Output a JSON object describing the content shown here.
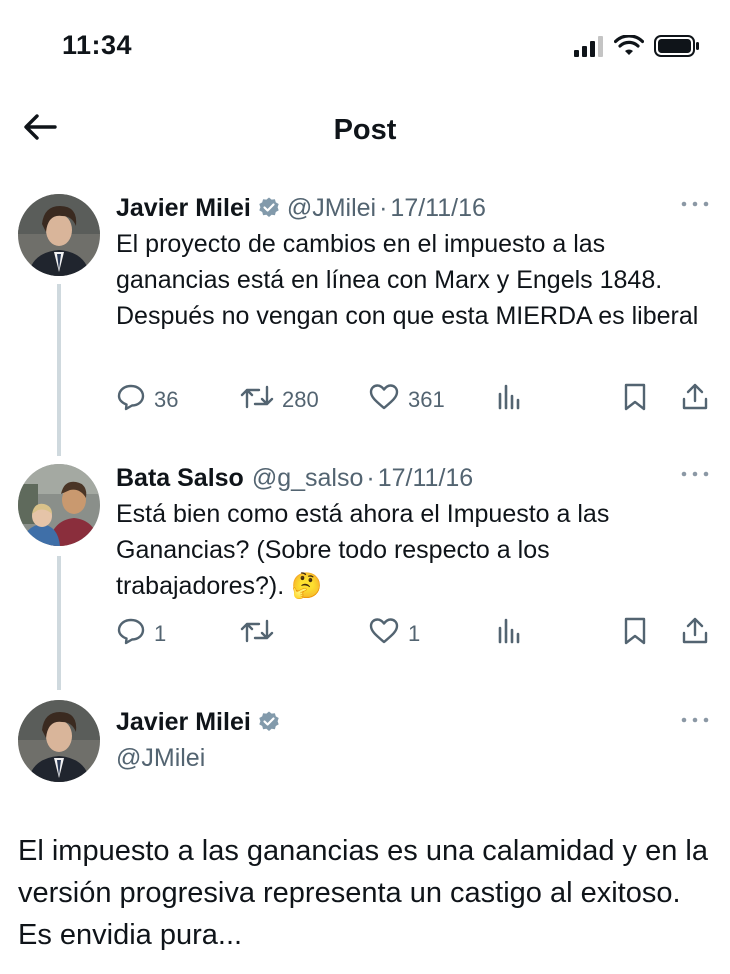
{
  "status_bar": {
    "time": "11:34"
  },
  "header": {
    "title": "Post"
  },
  "tweets": [
    {
      "name": "Javier Milei",
      "handle": "@JMilei",
      "separator": "·",
      "date": "17/11/16",
      "text": "El proyecto de cambios en el impuesto a las ganancias está en línea con Marx y Engels 1848. Después no vengan con que esta MIERDA es liberal",
      "replies": "36",
      "reposts": "280",
      "likes": "361"
    },
    {
      "name": "Bata Salso",
      "handle": "@g_salso",
      "separator": "·",
      "date": "17/11/16",
      "text": "Está bien como está ahora el Impuesto a las Ganancias? (Sobre todo respecto a los trabajadores?). 🤔",
      "replies": "1",
      "reposts": "",
      "likes": "1"
    }
  ],
  "main_tweet": {
    "name": "Javier Milei",
    "handle": "@JMilei",
    "text": "El impuesto a las ganancias es una calamidad y en la versión progresiva representa un castigo al exitoso. Es envidia pura..."
  },
  "colors": {
    "text": "#0f1419",
    "secondary": "#536471",
    "verified": "#829aab",
    "thread_line": "#cfd9de"
  },
  "icons": [
    "back-arrow-icon",
    "verified-badge-icon",
    "more-icon",
    "reply-icon",
    "repost-icon",
    "like-icon",
    "views-icon",
    "bookmark-icon",
    "share-icon",
    "signal-icon",
    "wifi-icon",
    "battery-icon"
  ]
}
